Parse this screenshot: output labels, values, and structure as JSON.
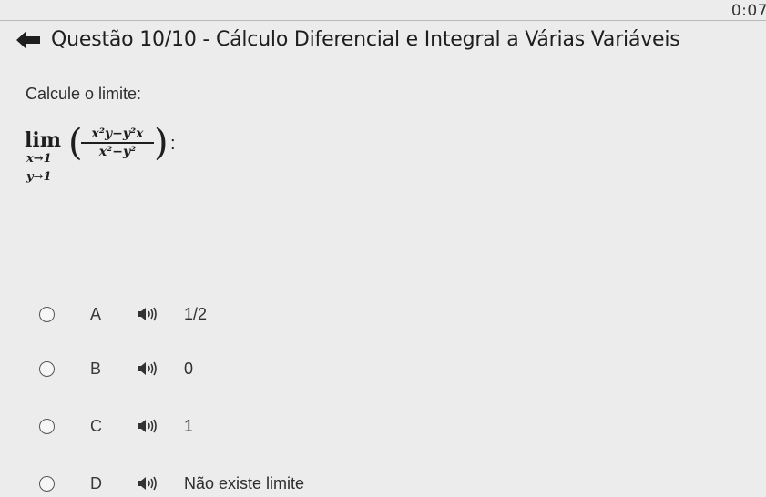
{
  "timer": "0:07",
  "header": {
    "title": "Questão 10/10 - Cálculo Diferencial e Integral a Várias Variáveis",
    "back_icon": "arrow-left-icon"
  },
  "question": {
    "prompt": "Calcule o limite:",
    "limit": {
      "lim": "lim",
      "sub_x": "x→1",
      "sub_y": "y→1",
      "open_paren": "(",
      "numerator": "x²y−y²x",
      "denominator": "x²−y²",
      "close_paren": ")",
      "colon": ":"
    }
  },
  "options": [
    {
      "letter": "A",
      "text": "1/2",
      "audio_icon": "speaker-icon"
    },
    {
      "letter": "B",
      "text": "0",
      "audio_icon": "speaker-icon"
    },
    {
      "letter": "C",
      "text": "1",
      "audio_icon": "speaker-icon"
    },
    {
      "letter": "D",
      "text": "Não existe limite",
      "audio_icon": "speaker-icon"
    }
  ],
  "colors": {
    "background": "#ececec",
    "text": "#2b2b2b",
    "rule": "#b9b9b9"
  }
}
